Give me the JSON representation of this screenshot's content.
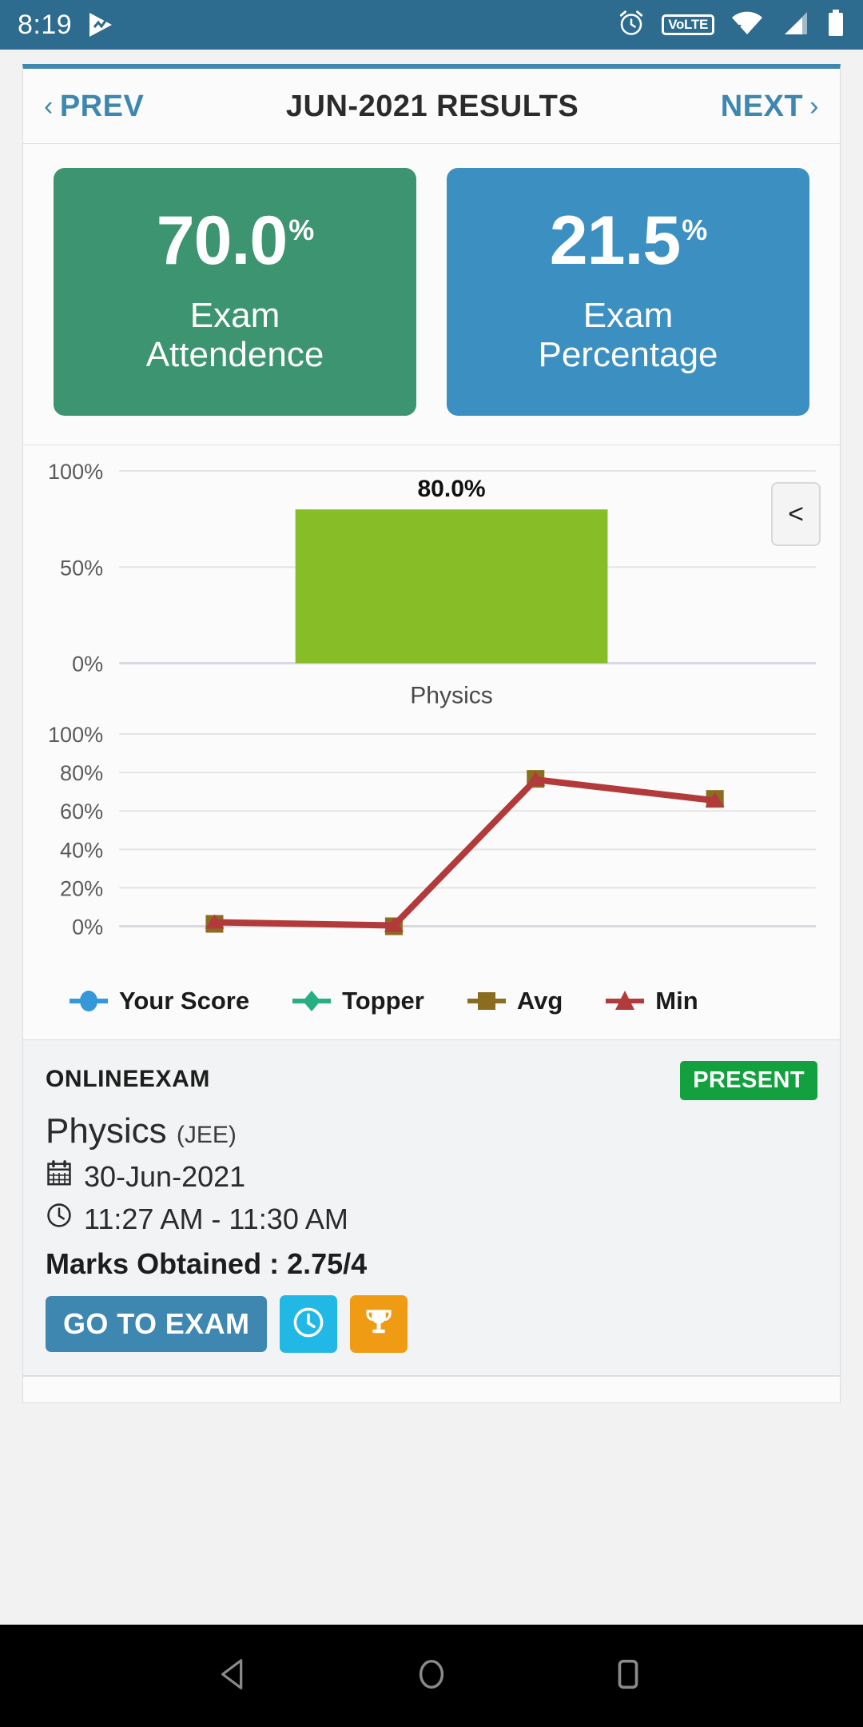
{
  "status_bar": {
    "time": "8:19",
    "left_icon": "play-notification-icon",
    "icons": [
      "alarm-icon",
      "volte-icon",
      "wifi-icon",
      "signal-icon",
      "battery-icon"
    ],
    "volte_label": "VoLTE",
    "background": "#2D6B8F"
  },
  "header": {
    "prev_label": "PREV",
    "prev_chevron": "‹",
    "title": "JUN-2021 RESULTS",
    "next_label": "NEXT",
    "next_chevron": "›",
    "accent": "#3E87B0"
  },
  "tiles": [
    {
      "value": "70.0",
      "unit": "%",
      "label_line1": "Exam",
      "label_line2": "Attendence",
      "color": "#3C9470"
    },
    {
      "value": "21.5",
      "unit": "%",
      "label_line1": "Exam",
      "label_line2": "Percentage",
      "color": "#3B8FC1"
    }
  ],
  "chart_nav": {
    "prev_label": "<"
  },
  "chart_data": [
    {
      "type": "bar",
      "title": "",
      "categories": [
        "Physics"
      ],
      "values": [
        80.0
      ],
      "data_labels": [
        "80.0%"
      ],
      "ylabel": "",
      "xlabel": "",
      "ylim": [
        0,
        100
      ],
      "ytick_labels": [
        "0%",
        "50%",
        "100%"
      ],
      "ytick_values": [
        0,
        50,
        100
      ],
      "grid": true,
      "bar_color": "#87BE28",
      "legend": null
    },
    {
      "type": "line",
      "title": "",
      "x": [
        "1",
        "2",
        "3",
        "4"
      ],
      "series": [
        {
          "name": "Your Score",
          "color": "#3498DB",
          "marker": "circle",
          "values": [
            null,
            null,
            null,
            null
          ]
        },
        {
          "name": "Topper",
          "color": "#27AE83",
          "marker": "diamond",
          "values": [
            null,
            null,
            null,
            null
          ]
        },
        {
          "name": "Avg",
          "color": "#8A6D1F",
          "marker": "square",
          "values": [
            2.5,
            2.0,
            81.0,
            71.0
          ]
        },
        {
          "name": "Min",
          "color": "#B33A3A",
          "marker": "triangle",
          "values": [
            2.0,
            1.5,
            80.0,
            70.0
          ]
        }
      ],
      "ylim": [
        0,
        100
      ],
      "ytick_labels": [
        "0%",
        "20%",
        "40%",
        "60%",
        "80%",
        "100%"
      ],
      "ytick_values": [
        0,
        20,
        40,
        60,
        80,
        100
      ],
      "grid": true,
      "legend_position": "bottom"
    }
  ],
  "legend": [
    {
      "label": "Your Score",
      "color": "#3498DB",
      "marker": "circle"
    },
    {
      "label": "Topper",
      "color": "#27AE83",
      "marker": "diamond"
    },
    {
      "label": "Avg",
      "color": "#8A6D1F",
      "marker": "square"
    },
    {
      "label": "Min",
      "color": "#B33A3A",
      "marker": "triangle"
    }
  ],
  "exam_card": {
    "exam_type": "ONLINEEXAM",
    "status_badge": "PRESENT",
    "status_color": "#12A13E",
    "subject": "Physics",
    "subject_group": "(JEE)",
    "date_icon": "calendar-icon",
    "date": "30-Jun-2021",
    "time_icon": "clock-icon",
    "time_range": "11:27 AM - 11:30 AM",
    "marks": "Marks Obtained : 2.75/4",
    "primary_button": "GO TO EXAM",
    "icon_button_1": "clock-icon",
    "icon_button_2": "trophy-icon"
  },
  "navbar": {
    "back": "back-triangle-icon",
    "home": "home-circle-icon",
    "recents": "recents-square-icon"
  }
}
